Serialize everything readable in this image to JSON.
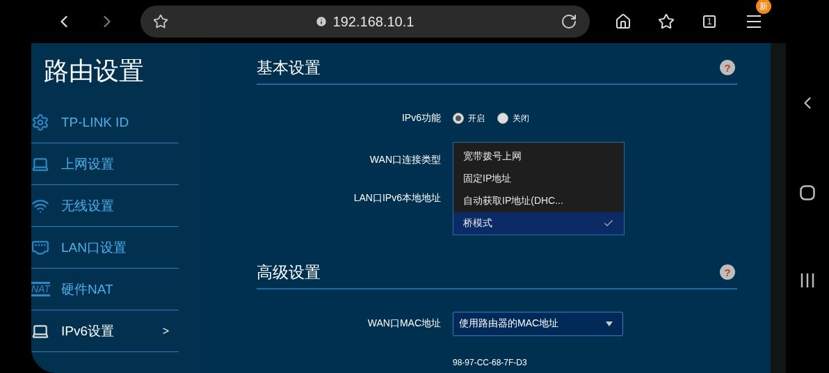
{
  "browser": {
    "url": "192.168.10.1",
    "tab_count": "1",
    "menu_badge": "新"
  },
  "sidebar": {
    "title": "路由设置",
    "items": [
      {
        "label": "TP-LINK ID",
        "kind": "gear",
        "selected": false
      },
      {
        "label": "上网设置",
        "kind": "laptop",
        "selected": false
      },
      {
        "label": "无线设置",
        "kind": "wifi",
        "selected": false
      },
      {
        "label": "LAN口设置",
        "kind": "ethernet",
        "selected": false
      },
      {
        "label": "硬件NAT",
        "kind": "nat",
        "icon_text": "NAT",
        "selected": false
      },
      {
        "label": "IPv6设置",
        "kind": "laptop",
        "selected": true,
        "chevron": ">"
      }
    ]
  },
  "basic": {
    "title": "基本设置",
    "help": "?",
    "ipv6_label": "IPv6功能",
    "ipv6_options": [
      {
        "label": "开启",
        "selected": true
      },
      {
        "label": "关闭",
        "selected": false
      }
    ],
    "wan_type_label": "WAN口连接类型",
    "lan_ipv6_label": "LAN口IPv6本地地址",
    "wan_type_options": [
      {
        "label": "宽带拨号上网",
        "selected": false
      },
      {
        "label": "固定IP地址",
        "selected": false
      },
      {
        "label": "自动获取IP地址(DHC...",
        "selected": false
      },
      {
        "label": "桥模式",
        "selected": true
      }
    ]
  },
  "advanced": {
    "title": "高级设置",
    "help": "?",
    "mac_label": "WAN口MAC地址",
    "mac_select": "使用路由器的MAC地址",
    "mac_value": "98-97-CC-68-7F-D3"
  }
}
